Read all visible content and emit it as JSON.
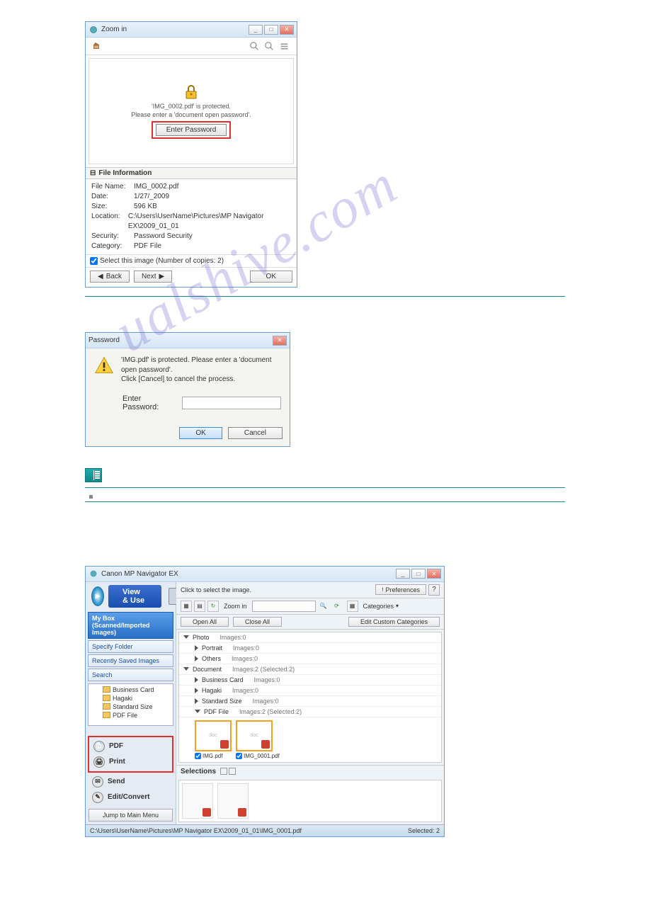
{
  "zoom_win": {
    "title": "Zoom in",
    "protected_line1": "'IMG_0002.pdf' is protected.",
    "protected_line2": "Please enter a 'document open password'.",
    "enter_password_btn": "Enter Password",
    "file_info_header": "File Information",
    "rows": {
      "r0k": "File Name:",
      "r0v": "IMG_0002.pdf",
      "r1k": "Date:",
      "r1v": "1/27/_2009",
      "r2k": "Size:",
      "r2v": "596 KB",
      "r3k": "Location:",
      "r3v": "C:\\Users\\UserName\\Pictures\\MP Navigator EX\\2009_01_01",
      "r4k": "Security:",
      "r4v": "Password Security",
      "r5k": "Category:",
      "r5v": "PDF File"
    },
    "select_line": "Select this image (Number of copies: 2)",
    "back": "Back",
    "next": "Next",
    "ok": "OK"
  },
  "pwd_dlg": {
    "title": "Password",
    "msg1": "'IMG.pdf' is protected. Please enter a 'document open password'.",
    "msg2": "Click [Cancel] to cancel the process.",
    "label": "Enter Password:",
    "ok": "OK",
    "cancel": "Cancel"
  },
  "nav_win": {
    "title": "Canon MP Navigator EX",
    "brand": "View & Use",
    "tabs": {
      "t0": "My Box (Scanned/Imported Images)",
      "t1": "Specify Folder",
      "t2": "Recently Saved Images",
      "t3": "Search"
    },
    "tree": {
      "i0": "Business Card",
      "i1": "Hagaki",
      "i2": "Standard Size",
      "i3": "PDF File"
    },
    "actions": {
      "pdf": "PDF",
      "print": "Print",
      "send": "Send",
      "edit": "Edit/Convert"
    },
    "jump": "Jump to Main Menu",
    "click_select": "Click to select the image.",
    "preferences": "Preferences",
    "zoom_in": "Zoom in",
    "categories_lbl": "Categories",
    "open_all": "Open All",
    "close_all": "Close All",
    "edit_custom": "Edit Custom Categories",
    "cats": {
      "photo": "Photo",
      "photo_c": "Images:0",
      "portrait": "Portrait",
      "portrait_c": "Images:0",
      "others": "Others",
      "others_c": "Images:0",
      "document": "Document",
      "document_c": "Images:2  (Selected:2)",
      "bcard": "Business Card",
      "bcard_c": "Images:0",
      "hagaki": "Hagaki",
      "hagaki_c": "Images:0",
      "std": "Standard Size",
      "std_c": "Images:0",
      "pdffile": "PDF File",
      "pdffile_c": "Images:2  (Selected:2)"
    },
    "thumb1": "IMG.pdf",
    "thumb2": "IMG_0001.pdf",
    "selections": "Selections",
    "status_path": "C:\\Users\\UserName\\Pictures\\MP Navigator EX\\2009_01_01\\IMG_0001.pdf",
    "status_sel": "Selected: 2"
  }
}
